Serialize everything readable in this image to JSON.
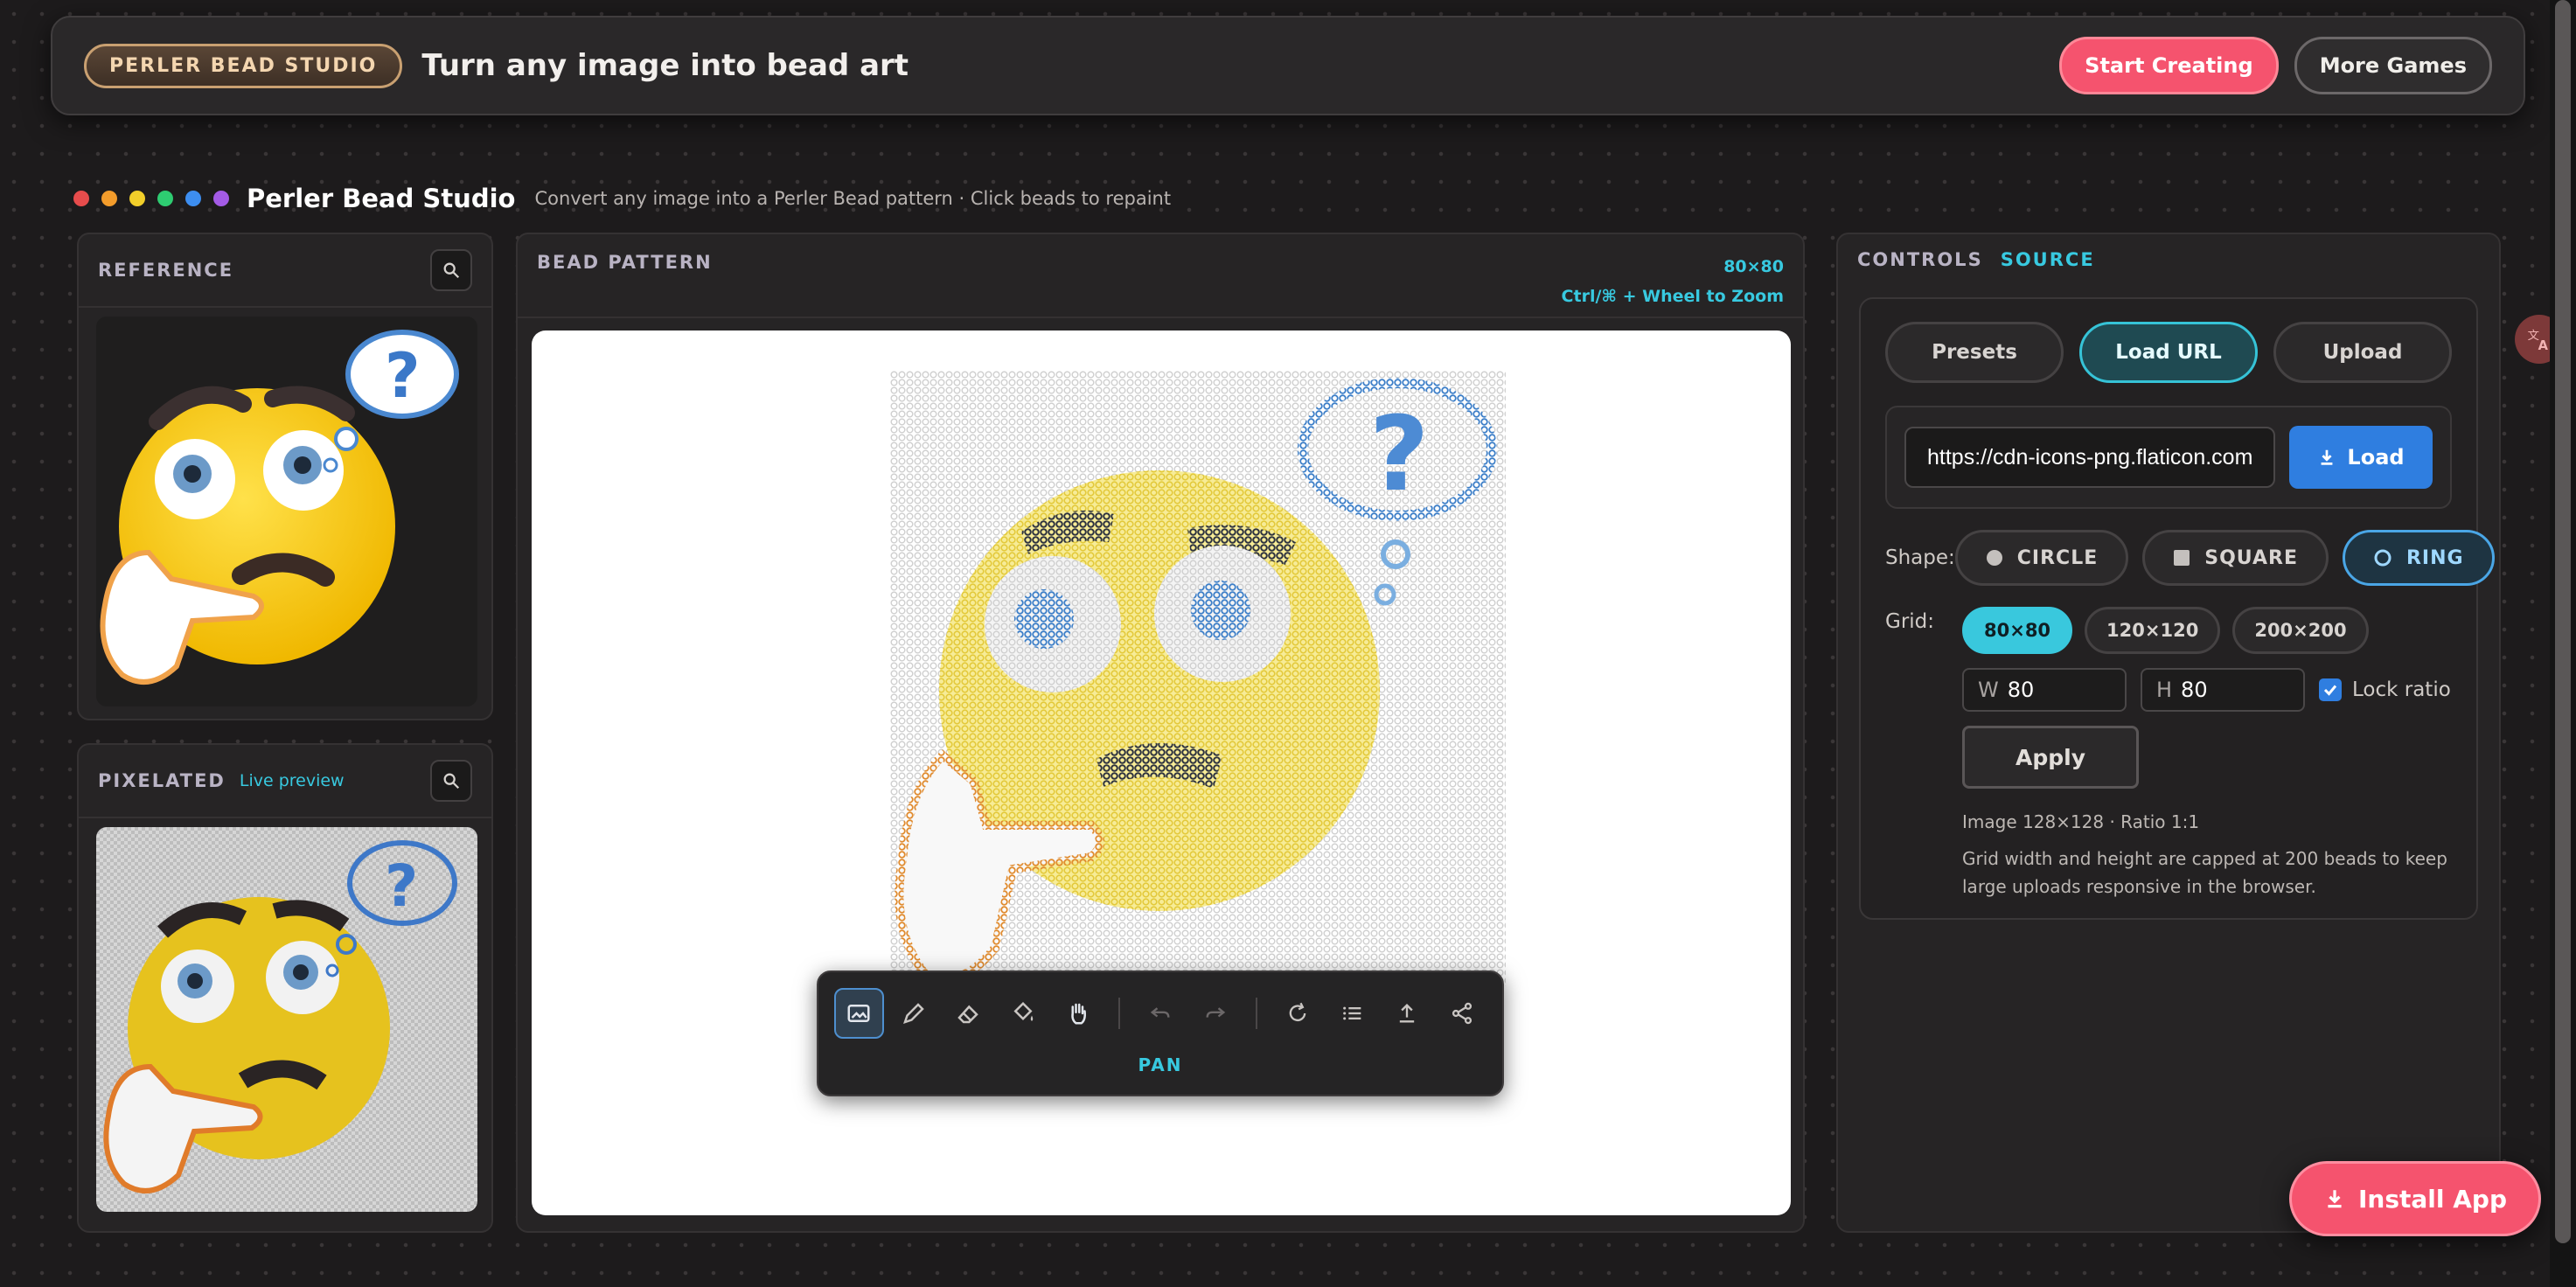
{
  "header": {
    "badge": "PERLER BEAD STUDIO",
    "tagline": "Turn any image into bead art",
    "start_label": "Start Creating",
    "more_label": "More Games"
  },
  "app": {
    "dots": [
      "#e74c4c",
      "#f39c2b",
      "#f2cf2a",
      "#2ecc71",
      "#3d8ef0",
      "#a45be6"
    ],
    "name": "Perler Bead Studio",
    "subtitle": "Convert any image into a Perler Bead pattern · Click beads to repaint"
  },
  "reference": {
    "label": "REFERENCE"
  },
  "pixelated": {
    "label": "PIXELATED",
    "live": "Live preview"
  },
  "pattern": {
    "label": "BEAD PATTERN",
    "size": "80×80",
    "zoom_hint": "Ctrl/⌘ + Wheel to Zoom"
  },
  "toolbar": {
    "icons": [
      "image-icon",
      "pencil-icon",
      "eraser-icon",
      "fill-bucket-icon",
      "hand-icon",
      "undo-icon",
      "redo-icon",
      "refresh-icon",
      "list-icon",
      "upload-icon",
      "share-icon"
    ],
    "active_label": "PAN"
  },
  "controls": {
    "tab_controls": "CONTROLS",
    "tab_source": "SOURCE",
    "source_tabs": [
      "Presets",
      "Load URL",
      "Upload"
    ],
    "active_source": "Load URL",
    "url_value": "https://cdn-icons-png.flaticon.com",
    "load_label": "Load",
    "shape_label": "Shape:",
    "shapes": [
      "CIRCLE",
      "SQUARE",
      "RING"
    ],
    "active_shape": "RING",
    "grid_label": "Grid:",
    "grids": [
      "80×80",
      "120×120",
      "200×200"
    ],
    "active_grid": "80×80",
    "w_label": "W",
    "w_value": "80",
    "h_label": "H",
    "h_value": "80",
    "lock_label": "Lock ratio",
    "apply_label": "Apply",
    "image_info": "Image 128×128 · Ratio 1:1",
    "cap_info": "Grid width and height are capped at 200 beads to keep large uploads responsive in the browser."
  },
  "install": {
    "label": "Install App"
  },
  "colors": {
    "accent": "#38c9e0",
    "pink": "#f5536e",
    "blue": "#2f7ee0"
  }
}
